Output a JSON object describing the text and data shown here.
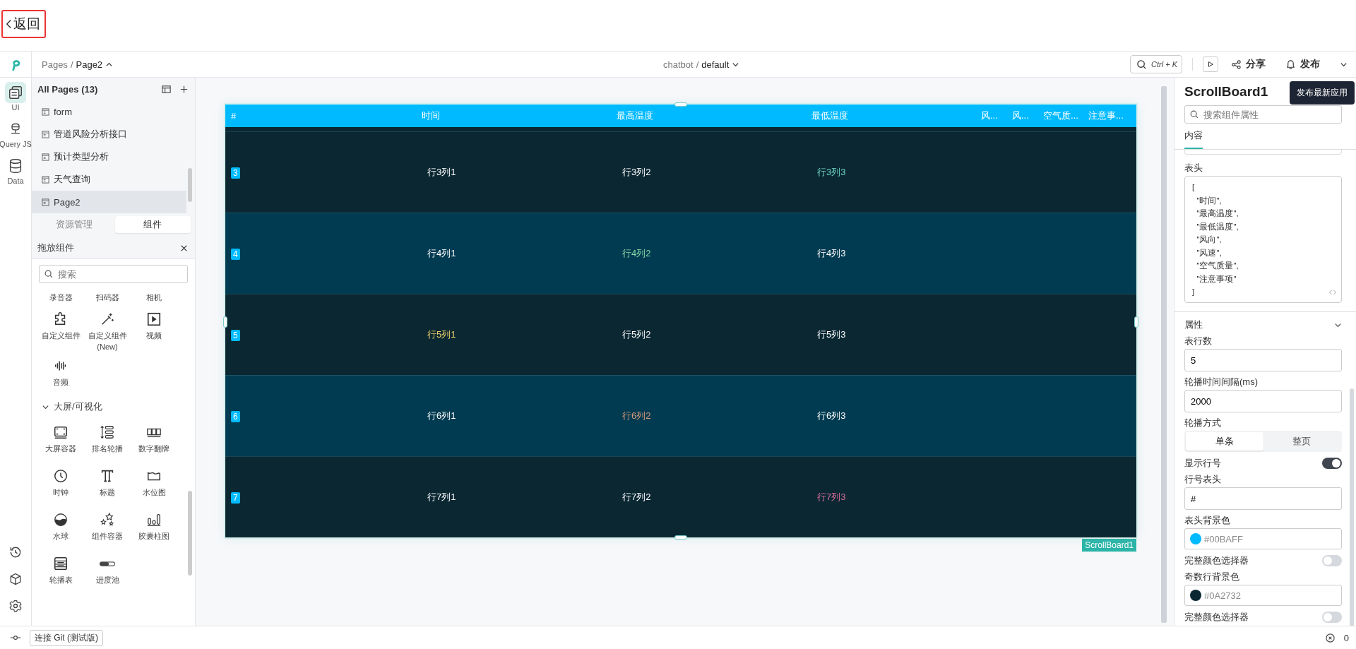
{
  "back_button": {
    "label": "返回"
  },
  "header": {
    "breadcrumb_root": "Pages",
    "breadcrumb_separator": "/",
    "breadcrumb_current": "Page2",
    "app_name": "chatbot",
    "app_separator": "/",
    "app_branch": "default",
    "search_shortcut": "Ctrl + K",
    "share_label": "分享",
    "publish_label": "发布",
    "tooltip": "发布最新应用"
  },
  "rail": {
    "items": [
      {
        "label": "UI",
        "selected": true
      },
      {
        "label": "Query JS",
        "selected": false
      },
      {
        "label": "Data",
        "selected": false
      }
    ]
  },
  "pages_panel": {
    "title": "All Pages (13)",
    "pages": [
      {
        "name": "form",
        "selected": false
      },
      {
        "name": "管道风险分析接口",
        "selected": false
      },
      {
        "name": "预计类型分析",
        "selected": false
      },
      {
        "name": "天气查询",
        "selected": false
      },
      {
        "name": "Page2",
        "selected": true
      }
    ]
  },
  "panel_tabs": [
    {
      "label": "资源管理",
      "selected": false
    },
    {
      "label": "组件",
      "selected": true
    }
  ],
  "components_panel": {
    "title": "拖放组件",
    "search_placeholder": "搜索",
    "partial_row": [
      "录音器",
      "扫码器",
      "相机"
    ],
    "items": [
      {
        "label": "自定义组件",
        "kind": "puzzle"
      },
      {
        "label": "自定义组件(New)",
        "kind": "wand"
      },
      {
        "label": "视频",
        "kind": "video"
      },
      {
        "label": "音频",
        "kind": "audio"
      }
    ],
    "groups": [
      {
        "title": "大屏/可视化",
        "expanded": true,
        "items": [
          {
            "label": "大屏容器",
            "kind": "screen"
          },
          {
            "label": "排名轮播",
            "kind": "ranking"
          },
          {
            "label": "数字翻牌",
            "kind": "flip"
          },
          {
            "label": "时钟",
            "kind": "clock"
          },
          {
            "label": "标题",
            "kind": "title"
          },
          {
            "label": "水位图",
            "kind": "level"
          },
          {
            "label": "水球",
            "kind": "ball"
          },
          {
            "label": "组件容器",
            "kind": "stars"
          },
          {
            "label": "胶囊柱图",
            "kind": "capsule"
          },
          {
            "label": "轮播表",
            "kind": "table"
          },
          {
            "label": "进度池",
            "kind": "progress"
          }
        ]
      }
    ]
  },
  "canvas": {
    "component_label": "ScrollBoard1",
    "table": {
      "index_header": "#",
      "columns": [
        "时间",
        "最高温度",
        "最低温度",
        "风...",
        "风...",
        "空气质...",
        "注意事..."
      ],
      "rows": [
        {
          "index": "3",
          "cells": [
            {
              "text": "行3列1",
              "color": "#ffffff"
            },
            {
              "text": "行3列2",
              "color": "#ffffff"
            },
            {
              "text": "行3列3",
              "color": "#6fd6c4"
            }
          ]
        },
        {
          "index": "4",
          "cells": [
            {
              "text": "行4列1",
              "color": "#ffffff"
            },
            {
              "text": "行4列2",
              "color": "#86dba8"
            },
            {
              "text": "行4列3",
              "color": "#ffffff"
            }
          ]
        },
        {
          "index": "5",
          "cells": [
            {
              "text": "行5列1",
              "color": "#f2d46b"
            },
            {
              "text": "行5列2",
              "color": "#ffffff"
            },
            {
              "text": "行5列3",
              "color": "#ffffff"
            }
          ]
        },
        {
          "index": "6",
          "cells": [
            {
              "text": "行6列1",
              "color": "#ffffff"
            },
            {
              "text": "行6列2",
              "color": "#d89a7c"
            },
            {
              "text": "行6列3",
              "color": "#ffffff"
            }
          ]
        },
        {
          "index": "7",
          "cells": [
            {
              "text": "行7列1",
              "color": "#ffffff"
            },
            {
              "text": "行7列2",
              "color": "#ffffff"
            },
            {
              "text": "行7列3",
              "color": "#d9709a"
            }
          ]
        }
      ]
    }
  },
  "inspector": {
    "title": "ScrollBoard1",
    "search_placeholder": "搜索组件属性",
    "tabs": [
      {
        "label": "内容",
        "selected": true
      }
    ],
    "header_label": "表头",
    "header_code": [
      "[",
      "  \"时间\",",
      "  \"最高温度\",",
      "  \"最低温度\",",
      "  \"风向\",",
      "  \"风速\",",
      "  \"空气质量\",",
      "  \"注意事项\"",
      "]"
    ],
    "section": {
      "title": "属性",
      "expanded": true
    },
    "properties": [
      {
        "kind": "input",
        "label": "表行数",
        "value": "5"
      },
      {
        "kind": "input",
        "label": "轮播时间间隔(ms)",
        "value": "2000"
      },
      {
        "kind": "segmented",
        "label": "轮播方式",
        "options": [
          {
            "label": "单条",
            "selected": true
          },
          {
            "label": "整页",
            "selected": false
          }
        ]
      },
      {
        "kind": "toggle",
        "label": "显示行号",
        "on": true
      },
      {
        "kind": "input",
        "label": "行号表头",
        "value": "#"
      },
      {
        "kind": "color",
        "label": "表头背景色",
        "value": "#00BAFF",
        "color": "#00baff"
      },
      {
        "kind": "toggle",
        "label": "完整颜色选择器",
        "on": false
      },
      {
        "kind": "color",
        "label": "奇数行背景色",
        "value": "#0A2732",
        "color": "#0a2732"
      },
      {
        "kind": "toggle",
        "label": "完整颜色选择器",
        "on": false
      }
    ]
  },
  "footer": {
    "git_button": "连接 Git (测试版)",
    "error_count": "0"
  }
}
